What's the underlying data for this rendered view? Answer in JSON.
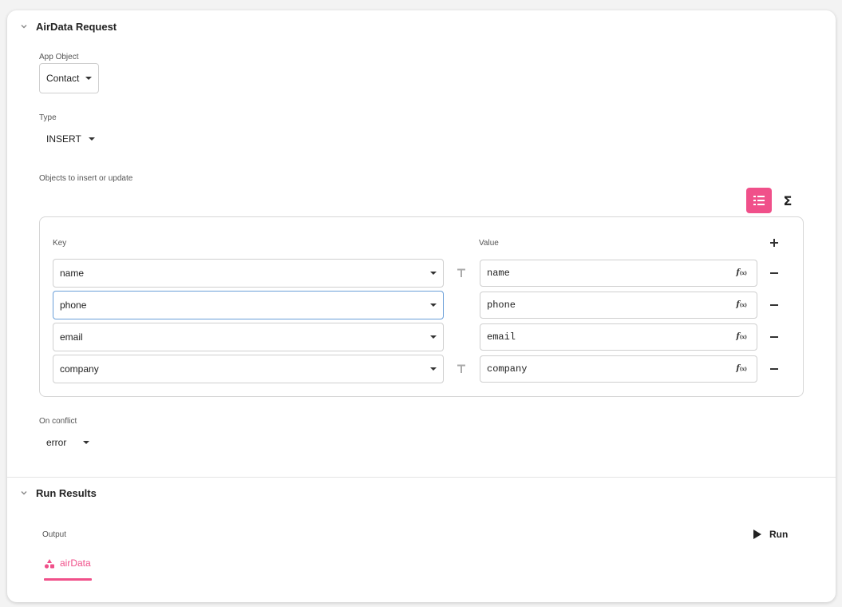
{
  "request_section": {
    "title": "AirData Request",
    "app_object": {
      "label": "App Object",
      "value": "Contact"
    },
    "type": {
      "label": "Type",
      "value": "INSERT"
    },
    "objects": {
      "label": "Objects to insert or update",
      "key_header": "Key",
      "value_header": "Value",
      "rows": [
        {
          "key": "name",
          "value": "name",
          "type_icon": "text-type-icon",
          "focused": false
        },
        {
          "key": "phone",
          "value": "phone",
          "type_icon": "",
          "focused": true
        },
        {
          "key": "email",
          "value": "email",
          "type_icon": "",
          "focused": false
        },
        {
          "key": "company",
          "value": "company",
          "type_icon": "text-type-icon",
          "focused": false
        }
      ],
      "fx_label": "f",
      "fx_sub": "(x)"
    },
    "on_conflict": {
      "label": "On conflict",
      "value": "error"
    }
  },
  "results_section": {
    "title": "Run Results",
    "output_label": "Output",
    "run_label": "Run",
    "output_tab": "airData"
  },
  "colors": {
    "accent": "#f0508a",
    "focus_border": "#6a9fd8"
  }
}
